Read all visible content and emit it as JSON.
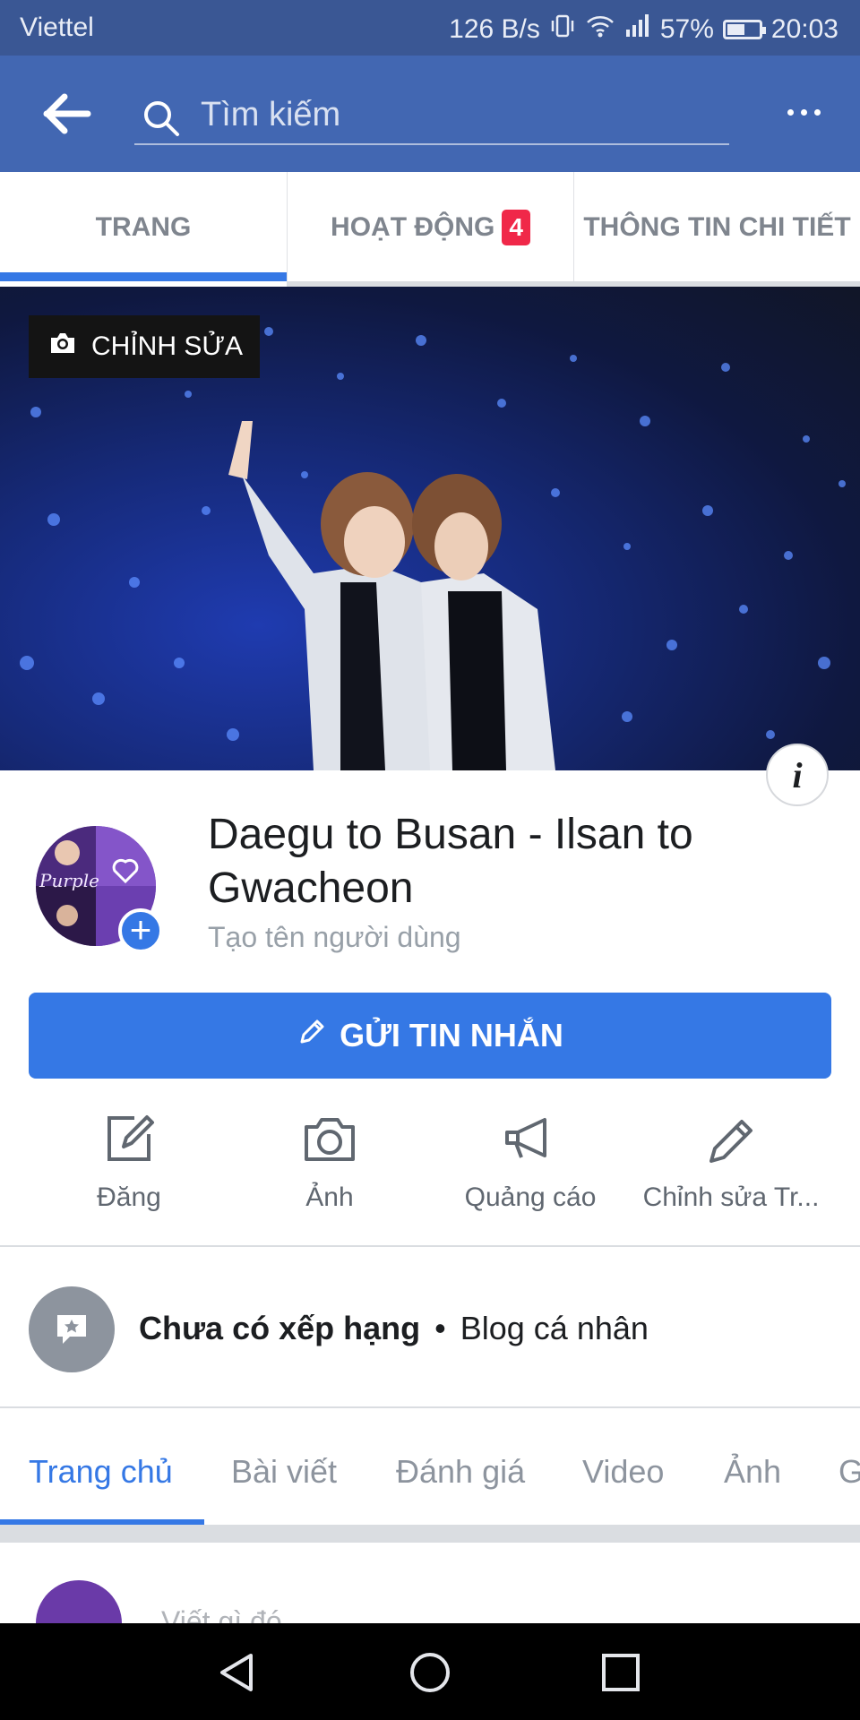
{
  "status_bar": {
    "carrier": "Viettel",
    "speed": "126 B/s",
    "battery": "57%",
    "battery_level": 0.57,
    "time": "20:03"
  },
  "app_bar": {
    "back_icon": "arrow-left-icon",
    "search_placeholder": "Tìm kiếm",
    "more_icon": "more-horizontal-icon"
  },
  "top_tabs": [
    {
      "label": "TRANG",
      "active": true
    },
    {
      "label": "HOẠT ĐỘNG",
      "badge": "4"
    },
    {
      "label": "THÔNG TIN CHI TIẾT"
    }
  ],
  "cover": {
    "edit_label": "CHỈNH SỬA",
    "info_label": "i"
  },
  "page": {
    "title": "Daegu to Busan - Ilsan to Gwacheon",
    "username_prompt": "Tạo tên người dùng",
    "avatar_text": "Purple"
  },
  "primary_action": {
    "label": "GỬI TIN NHẮN",
    "icon": "pencil-icon"
  },
  "actions": [
    {
      "label": "Đăng",
      "icon": "compose-icon"
    },
    {
      "label": "Ảnh",
      "icon": "camera-icon"
    },
    {
      "label": "Quảng cáo",
      "icon": "megaphone-icon"
    },
    {
      "label": "Chỉnh sửa Tr...",
      "icon": "pencil-icon"
    }
  ],
  "rating": {
    "status": "Chưa có xếp hạng",
    "separator": "•",
    "category": "Blog cá nhân"
  },
  "sub_tabs": [
    {
      "label": "Trang chủ",
      "active": true
    },
    {
      "label": "Bài viết"
    },
    {
      "label": "Đánh giá"
    },
    {
      "label": "Video"
    },
    {
      "label": "Ảnh"
    },
    {
      "label": "G"
    }
  ],
  "composer": {
    "placeholder": "Viết gì đó..."
  },
  "colors": {
    "brand": "#4267b2",
    "accent": "#3578e5",
    "badge": "#f02849"
  }
}
